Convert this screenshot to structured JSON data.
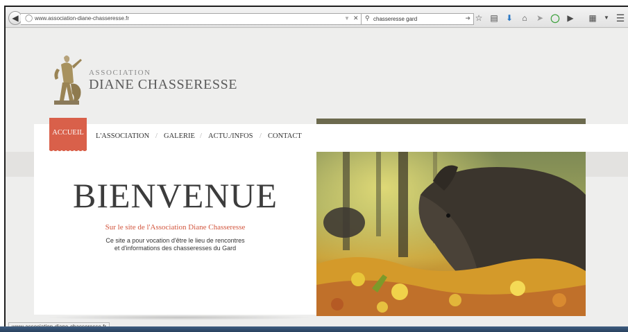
{
  "browser": {
    "url": "www.association-diane-chasseresse.fr",
    "search_query": "chasseresse gard"
  },
  "site": {
    "logo_small": "ASSOCIATION",
    "logo_big": "DIANE CHASSERESSE"
  },
  "nav": {
    "items": [
      {
        "label": "ACCUEIL",
        "active": true
      },
      {
        "label": "L'ASSOCIATION",
        "active": false
      },
      {
        "label": "GALERIE",
        "active": false
      },
      {
        "label": "ACTU./INFOS",
        "active": false
      },
      {
        "label": "CONTACT",
        "active": false
      }
    ],
    "separator": "/"
  },
  "hero": {
    "title": "BIENVENUE",
    "tagline": "Sur le site de l'Association Diane Chasseresse",
    "description_line1": "Ce site a pour vocation d'être le lieu de rencontres",
    "description_line2": "et d'informations des chasseresses du Gard"
  },
  "status_bar": {
    "text": "www.association-diane-chasseresse.fr"
  },
  "colors": {
    "accent": "#d9604a",
    "tagline": "#d2553d",
    "title": "#3c3c3c"
  }
}
